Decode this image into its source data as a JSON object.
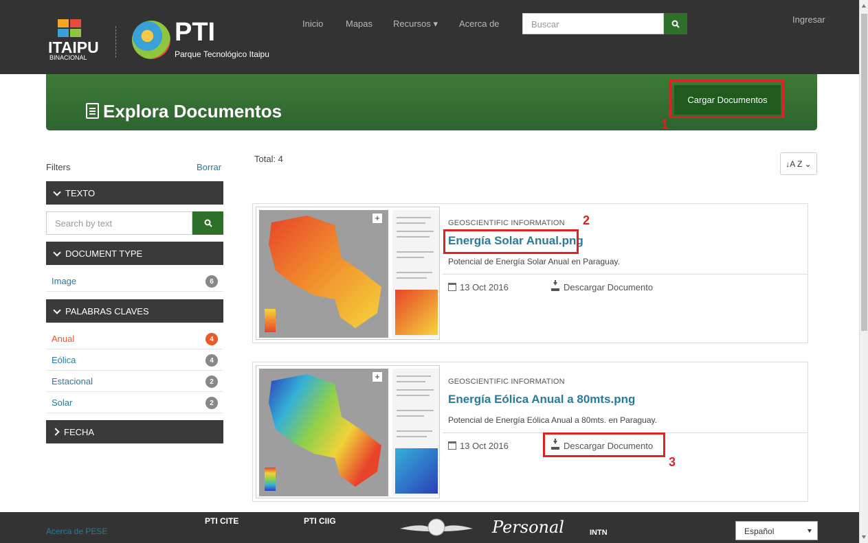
{
  "header": {
    "itaipu_logo": "ITAIPU",
    "itaipu_sub": "BINACIONAL",
    "pti_logo": "PTI",
    "pti_sub": "Parque Tecnológico Itaipu",
    "nav": [
      "Inicio",
      "Mapas",
      "Recursos ▾",
      "Acerca de"
    ],
    "search_placeholder": "Buscar",
    "login": "Ingresar"
  },
  "banner": {
    "title": "Explora Documentos",
    "upload_label": "Cargar Documentos",
    "annotation_1": "1"
  },
  "sidebar": {
    "filters_label": "Filters",
    "clear_label": "Borrar",
    "text_facet": "TEXTO",
    "text_placeholder": "Search by text",
    "doctype_facet": "DOCUMENT TYPE",
    "doctypes": [
      {
        "label": "Image",
        "count": "6"
      }
    ],
    "keywords_facet": "PALABRAS CLAVES",
    "keywords": [
      {
        "label": "Anual",
        "count": "4"
      },
      {
        "label": "Eólica",
        "count": "4"
      },
      {
        "label": "Estacional",
        "count": "2"
      },
      {
        "label": "Solar",
        "count": "2"
      }
    ],
    "date_facet": "FECHA"
  },
  "results": {
    "total_label": "Total: 4",
    "sort_label": "↓A Z ⌄",
    "items": [
      {
        "category": "GEOSCIENTIFIC INFORMATION",
        "title": "Energía Solar Anual.png",
        "description": "Potencial de Energía Solar Anual en Paraguay.",
        "date": "13 Oct 2016",
        "download_label": "Descargar Documento"
      },
      {
        "category": "GEOSCIENTIFIC INFORMATION",
        "title": "Energía Eólica Anual a 80mts.png",
        "description": "Potencial de Energía Eólica Anual a 80mts. en Paraguay.",
        "date": "13 Oct 2016",
        "download_label": "Descargar Documento"
      }
    ],
    "annotation_2": "2",
    "annotation_3": "3"
  },
  "footer": {
    "about_link": "Acerca de PESE",
    "logos": [
      "PTI CITE",
      "PTI CIIG",
      "Personal",
      "INTN"
    ],
    "language": "Español"
  },
  "colors": {
    "nav_bg": "#333333",
    "banner_green": "#336b2f",
    "accent_green": "#2e6f2a",
    "link_blue": "#2a7a9b",
    "active_orange": "#e85a2a",
    "annotation_red": "#dd2222"
  }
}
